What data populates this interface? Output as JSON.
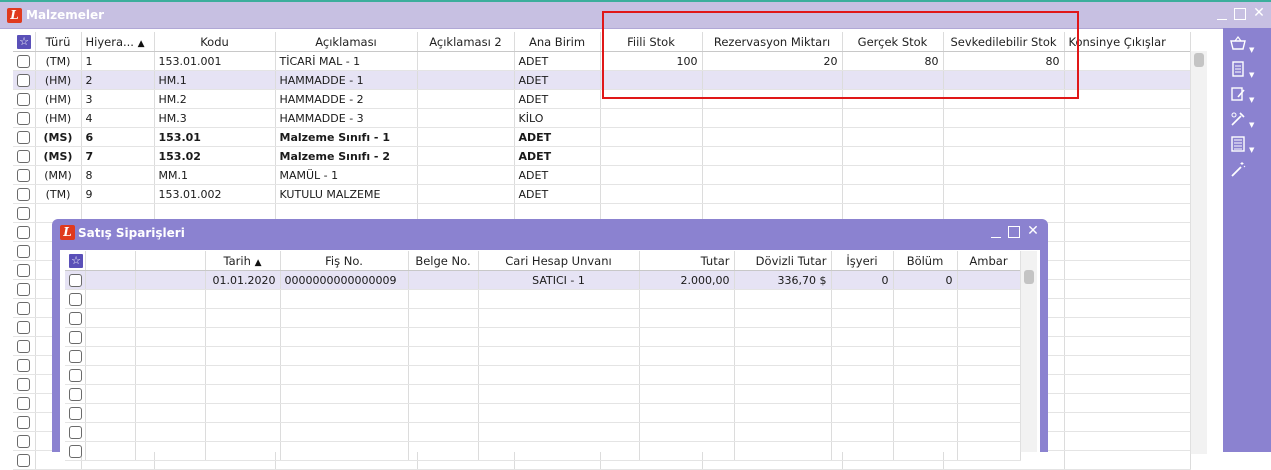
{
  "main_window": {
    "title": "Malzemeler",
    "columns": [
      "Türü",
      "Hiyera...",
      "Kodu",
      "Açıklaması",
      "Açıklaması 2",
      "Ana Birim",
      "Fiili Stok",
      "Rezervasyon Miktarı",
      "Gerçek Stok",
      "Sevkedilebilir Stok",
      "Konsinye Çıkışlar"
    ],
    "rows": [
      {
        "turu": "(TM)",
        "hiyerarsi": "1",
        "kodu": "153.01.001",
        "aciklama": "TİCARİ MAL - 1",
        "aciklama2": "",
        "birim": "ADET",
        "fiili": "100",
        "rezervasyon": "20",
        "gercek": "80",
        "sevkedilebilir": "80",
        "konsinye": "",
        "bold": false,
        "selected": false
      },
      {
        "turu": "(HM)",
        "hiyerarsi": "2",
        "kodu": "HM.1",
        "aciklama": "HAMMADDE - 1",
        "aciklama2": "",
        "birim": "ADET",
        "fiili": "",
        "rezervasyon": "",
        "gercek": "",
        "sevkedilebilir": "",
        "konsinye": "",
        "bold": false,
        "selected": true
      },
      {
        "turu": "(HM)",
        "hiyerarsi": "3",
        "kodu": "HM.2",
        "aciklama": "HAMMADDE - 2",
        "aciklama2": "",
        "birim": "ADET",
        "fiili": "",
        "rezervasyon": "",
        "gercek": "",
        "sevkedilebilir": "",
        "konsinye": "",
        "bold": false,
        "selected": false
      },
      {
        "turu": "(HM)",
        "hiyerarsi": "4",
        "kodu": "HM.3",
        "aciklama": "HAMMADDE - 3",
        "aciklama2": "",
        "birim": "KİLO",
        "fiili": "",
        "rezervasyon": "",
        "gercek": "",
        "sevkedilebilir": "",
        "konsinye": "",
        "bold": false,
        "selected": false
      },
      {
        "turu": "(MS)",
        "hiyerarsi": "6",
        "kodu": "153.01",
        "aciklama": "Malzeme Sınıfı - 1",
        "aciklama2": "",
        "birim": "ADET",
        "fiili": "",
        "rezervasyon": "",
        "gercek": "",
        "sevkedilebilir": "",
        "konsinye": "",
        "bold": true,
        "selected": false
      },
      {
        "turu": "(MS)",
        "hiyerarsi": "7",
        "kodu": "153.02",
        "aciklama": "Malzeme Sınıfı - 2",
        "aciklama2": "",
        "birim": "ADET",
        "fiili": "",
        "rezervasyon": "",
        "gercek": "",
        "sevkedilebilir": "",
        "konsinye": "",
        "bold": true,
        "selected": false
      },
      {
        "turu": "(MM)",
        "hiyerarsi": "8",
        "kodu": "MM.1",
        "aciklama": "MAMÜL - 1",
        "aciklama2": "",
        "birim": "ADET",
        "fiili": "",
        "rezervasyon": "",
        "gercek": "",
        "sevkedilebilir": "",
        "konsinye": "",
        "bold": false,
        "selected": false
      },
      {
        "turu": "(TM)",
        "hiyerarsi": "9",
        "kodu": "153.01.002",
        "aciklama": "KUTULU MALZEME",
        "aciklama2": "",
        "birim": "ADET",
        "fiili": "",
        "rezervasyon": "",
        "gercek": "",
        "sevkedilebilir": "",
        "konsinye": "",
        "bold": false,
        "selected": false
      }
    ]
  },
  "sub_window": {
    "title": "Satış Siparişleri",
    "columns": [
      "Tarih",
      "Fiş No.",
      "Belge No.",
      "Cari Hesap Unvanı",
      "Tutar",
      "Dövizli Tutar",
      "İşyeri",
      "Bölüm",
      "Ambar"
    ],
    "rows": [
      {
        "tarih": "01.01.2020",
        "fis_no": "0000000000000009",
        "belge_no": "",
        "cari": "SATICI - 1",
        "tutar": "2.000,00",
        "dovizli": "336,70 $",
        "isyeri": "0",
        "bolum": "0",
        "ambar": ""
      }
    ]
  },
  "icons": {
    "logo": "L",
    "star": "☆",
    "sort": "▲",
    "toolbar": [
      "basket-icon",
      "document-icon",
      "edit-document-icon",
      "tools-icon",
      "list-icon",
      "magic-wand-icon"
    ]
  },
  "colors": {
    "title_bar_main": "#c7c0e2",
    "title_bar_sub": "#8b82d0",
    "toolbar": "#8b82d0",
    "highlight": "#e01818",
    "logo": "#e03a1e"
  }
}
